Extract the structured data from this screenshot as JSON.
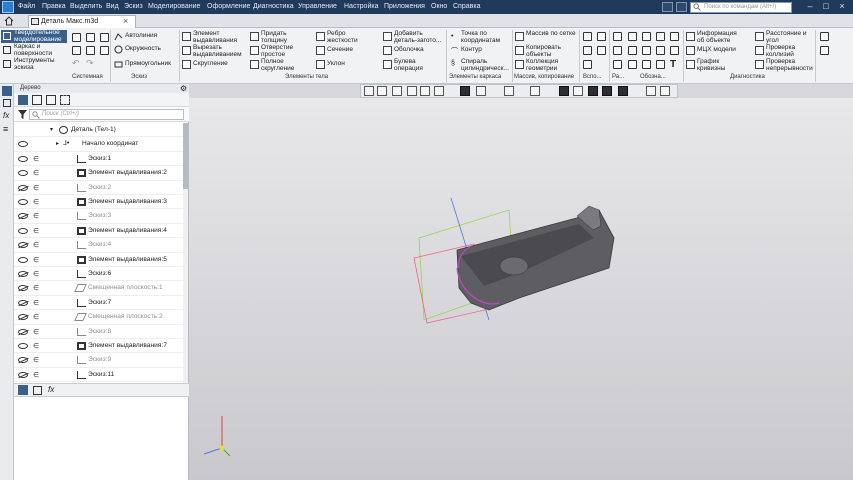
{
  "menubar": {
    "items": [
      "Файл",
      "Правка",
      "Выделить",
      "Вид",
      "Эскиз",
      "Моделирование",
      "Оформление",
      "Диагностика",
      "Управление",
      "Настройка",
      "Приложения",
      "Окно",
      "Справка"
    ],
    "search_placeholder": "Поиск по командам (Alt+/)"
  },
  "tabs": {
    "document": "Деталь Макс.m3d"
  },
  "modes": [
    "Твердотельное моделирование",
    "Каркас и поверхности",
    "Инструменты эскиза"
  ],
  "ribbon": {
    "groups": [
      "Системная",
      "Эскиз",
      "Элементы тела",
      "Элементы каркаса",
      "Массив, копирование",
      "Вспо...",
      "Ра...",
      "Обозна...",
      "Диагностика"
    ],
    "sketch": [
      "Автолиния",
      "Окружность",
      "Прямоугольник"
    ],
    "body": [
      "Элемент выдавливания",
      "Вырезать выдавливанием",
      "Скругление",
      "Придать толщину",
      "Отверстие простое",
      "Полное скругление",
      "Ребро жесткости",
      "Сечение",
      "Уклон",
      "Добавить деталь-загото...",
      "Оболочка",
      "Булева операция"
    ],
    "wire": [
      "Точка по координатам",
      "Контур",
      "Спираль цилиндрическ..."
    ],
    "array": [
      "Массив по сетке",
      "Копировать объекты",
      "Коллекция геометрии"
    ],
    "diag": [
      "Информация об объекте",
      "МЦХ модели",
      "График кривизны",
      "Расстояние и угол",
      "Проверка коллизий",
      "Проверка непрерывности"
    ]
  },
  "tree": {
    "title": "Дерево",
    "search_placeholder": "Поиск (Ctrl+/)",
    "items": [
      {
        "label": "Деталь (Тел-1)"
      },
      {
        "label": "Начало координат"
      },
      {
        "label": "Эскиз:1"
      },
      {
        "label": "Элемент выдавливания:2"
      },
      {
        "label": "Эскиз:2"
      },
      {
        "label": "Элемент выдавливания:3"
      },
      {
        "label": "Эскиз:3"
      },
      {
        "label": "Элемент выдавливания:4"
      },
      {
        "label": "Эскиз:4"
      },
      {
        "label": "Элемент выдавливания:5"
      },
      {
        "label": "Эскиз:6"
      },
      {
        "label": "Смещенная плоскость:1"
      },
      {
        "label": "Эскиз:7"
      },
      {
        "label": "Смещенная плоскость:2"
      },
      {
        "label": "Эскиз:8"
      },
      {
        "label": "Элемент выдавливания:7"
      },
      {
        "label": "Эскиз:9"
      },
      {
        "label": "Эскиз:11"
      }
    ]
  },
  "colors": {
    "menubar": "#1f3a5a",
    "accent": "#3a5f8a",
    "model": "#5c5c60"
  }
}
